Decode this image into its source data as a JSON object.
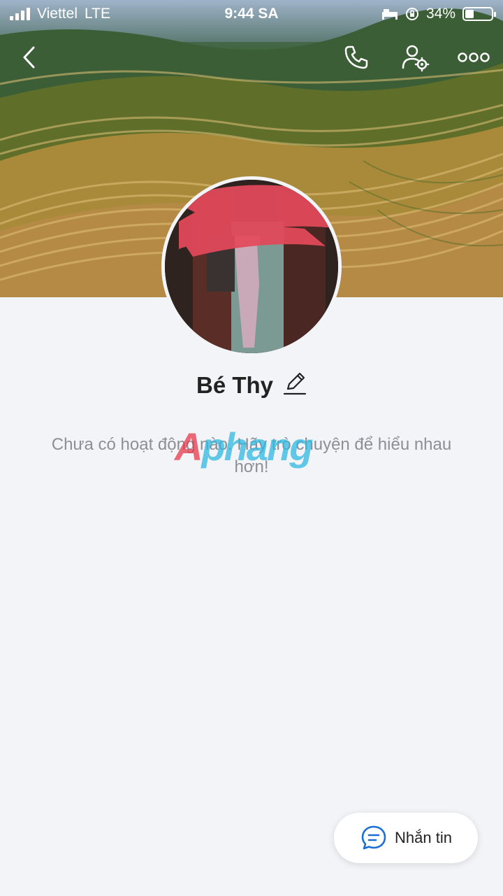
{
  "status_bar": {
    "carrier": "Viettel",
    "network": "LTE",
    "time": "9:44 SA",
    "battery": "34%",
    "battery_level": 0.34
  },
  "icons": {
    "back": "chevron-left-icon",
    "call": "phone-icon",
    "profile_settings": "user-gear-icon",
    "more": "more-dots-icon",
    "edit": "pencil-icon",
    "message": "chat-bubble-icon"
  },
  "profile": {
    "name": "Bé Thy"
  },
  "empty_state": {
    "message": "Chưa có hoạt động nào. Hãy trò chuyện để hiểu nhau hơn!"
  },
  "watermark": {
    "first": "A",
    "rest": "phang"
  },
  "actions": {
    "message_label": "Nhắn tin"
  },
  "colors": {
    "background": "#f3f4f8",
    "accent": "#1a6fd6",
    "text": "#222222",
    "muted": "#8c8f96"
  }
}
